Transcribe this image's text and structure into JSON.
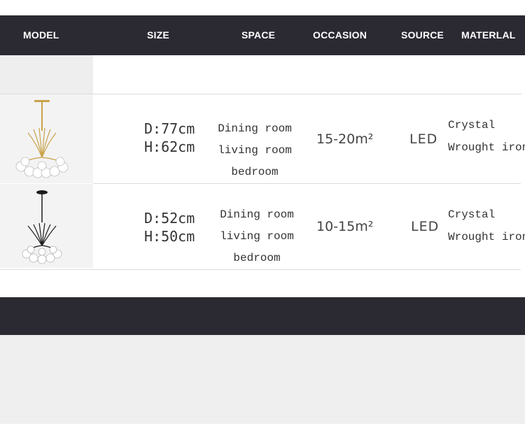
{
  "header": {
    "columns": [
      {
        "key": "model",
        "label": "MODEL"
      },
      {
        "key": "size",
        "label": "SIZE"
      },
      {
        "key": "space",
        "label": "SPACE"
      },
      {
        "key": "occasion",
        "label": "OCCASION"
      },
      {
        "key": "source",
        "label": "SOURCE"
      },
      {
        "key": "material",
        "label": "MATERLAL"
      }
    ]
  },
  "rows": [
    {
      "image_icon": "gold-chandelier-image",
      "finish_color": "#c9a24a",
      "size_d": "D:77cm",
      "size_h": "H:62cm",
      "space": [
        "Dining room",
        "living room",
        "bedroom"
      ],
      "occasion": "15-20m²",
      "source": "LED",
      "material": [
        "Crystal",
        "Wrought iron"
      ]
    },
    {
      "image_icon": "black-chandelier-image",
      "finish_color": "#1c1c1c",
      "size_d": "D:52cm",
      "size_h": "H:50cm",
      "space": [
        "Dining room",
        "living room",
        "bedroom"
      ],
      "occasion": "10-15m²",
      "source": "LED",
      "material": [
        "Crystal",
        "Wrought iron"
      ]
    }
  ],
  "colors": {
    "header_bg": "#2b2a33",
    "header_text": "#ffffff",
    "panel_bg": "#efefef"
  }
}
